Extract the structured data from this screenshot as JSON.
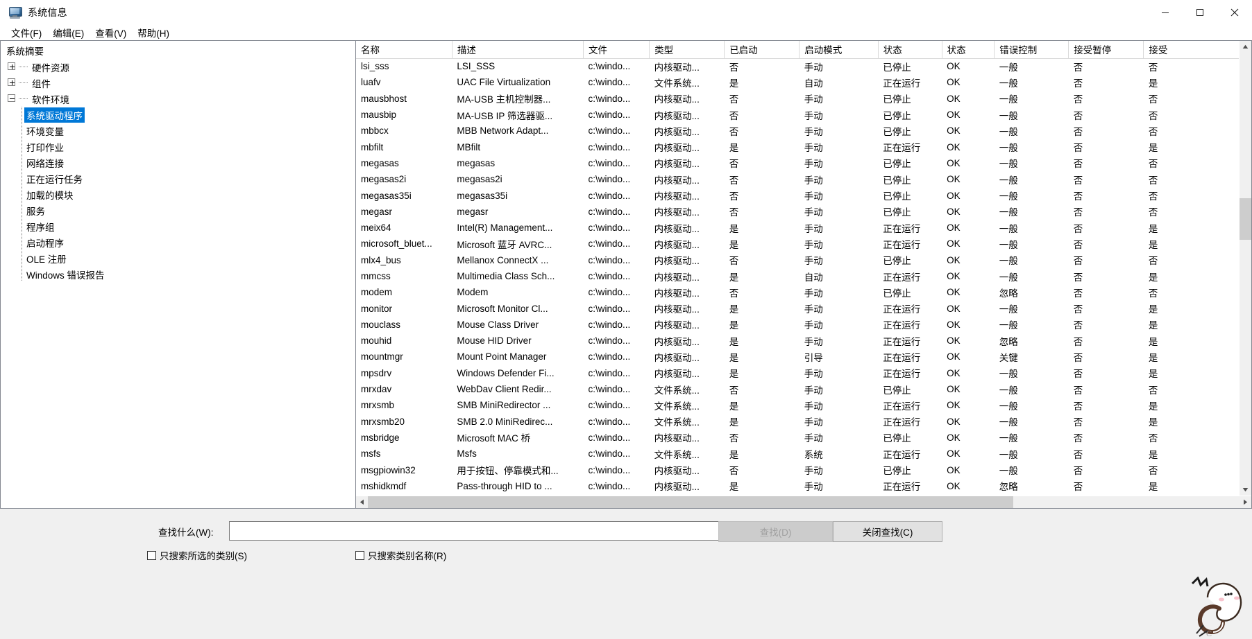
{
  "window": {
    "title": "系统信息",
    "icon": "computer-icon",
    "minimize_label": "最小化",
    "maximize_label": "最大化",
    "close_label": "关闭"
  },
  "menu": {
    "items": [
      {
        "label": "文件(F)"
      },
      {
        "label": "编辑(E)"
      },
      {
        "label": "查看(V)"
      },
      {
        "label": "帮助(H)"
      }
    ]
  },
  "sidebar": {
    "root": "系统摘要",
    "groups": [
      {
        "label": "硬件资源",
        "expanded": false
      },
      {
        "label": "组件",
        "expanded": false
      },
      {
        "label": "软件环境",
        "expanded": true
      }
    ],
    "items": [
      {
        "label": "系统驱动程序",
        "selected": true
      },
      {
        "label": "环境变量",
        "selected": false
      },
      {
        "label": "打印作业",
        "selected": false
      },
      {
        "label": "网络连接",
        "selected": false
      },
      {
        "label": "正在运行任务",
        "selected": false
      },
      {
        "label": "加载的模块",
        "selected": false
      },
      {
        "label": "服务",
        "selected": false
      },
      {
        "label": "程序组",
        "selected": false
      },
      {
        "label": "启动程序",
        "selected": false
      },
      {
        "label": "OLE 注册",
        "selected": false
      },
      {
        "label": "Windows 错误报告",
        "selected": false
      }
    ]
  },
  "table": {
    "columns": [
      "名称",
      "描述",
      "文件",
      "类型",
      "已启动",
      "启动模式",
      "状态",
      "状态",
      "错误控制",
      "接受暂停",
      "接受"
    ],
    "rows": [
      [
        "lsi_sss",
        "LSI_SSS",
        "c:\\windo...",
        "内核驱动...",
        "否",
        "手动",
        "已停止",
        "OK",
        "一般",
        "否",
        "否"
      ],
      [
        "luafv",
        "UAC File Virtualization",
        "c:\\windo...",
        "文件系统...",
        "是",
        "自动",
        "正在运行",
        "OK",
        "一般",
        "否",
        "是"
      ],
      [
        "mausbhost",
        "MA-USB 主机控制器...",
        "c:\\windo...",
        "内核驱动...",
        "否",
        "手动",
        "已停止",
        "OK",
        "一般",
        "否",
        "否"
      ],
      [
        "mausbip",
        "MA-USB IP 筛选器驱...",
        "c:\\windo...",
        "内核驱动...",
        "否",
        "手动",
        "已停止",
        "OK",
        "一般",
        "否",
        "否"
      ],
      [
        "mbbcx",
        "MBB Network Adapt...",
        "c:\\windo...",
        "内核驱动...",
        "否",
        "手动",
        "已停止",
        "OK",
        "一般",
        "否",
        "否"
      ],
      [
        "mbfilt",
        "MBfilt",
        "c:\\windo...",
        "内核驱动...",
        "是",
        "手动",
        "正在运行",
        "OK",
        "一般",
        "否",
        "是"
      ],
      [
        "megasas",
        "megasas",
        "c:\\windo...",
        "内核驱动...",
        "否",
        "手动",
        "已停止",
        "OK",
        "一般",
        "否",
        "否"
      ],
      [
        "megasas2i",
        "megasas2i",
        "c:\\windo...",
        "内核驱动...",
        "否",
        "手动",
        "已停止",
        "OK",
        "一般",
        "否",
        "否"
      ],
      [
        "megasas35i",
        "megasas35i",
        "c:\\windo...",
        "内核驱动...",
        "否",
        "手动",
        "已停止",
        "OK",
        "一般",
        "否",
        "否"
      ],
      [
        "megasr",
        "megasr",
        "c:\\windo...",
        "内核驱动...",
        "否",
        "手动",
        "已停止",
        "OK",
        "一般",
        "否",
        "否"
      ],
      [
        "meix64",
        "Intel(R) Management...",
        "c:\\windo...",
        "内核驱动...",
        "是",
        "手动",
        "正在运行",
        "OK",
        "一般",
        "否",
        "是"
      ],
      [
        "microsoft_bluet...",
        "Microsoft 蓝牙 AVRC...",
        "c:\\windo...",
        "内核驱动...",
        "是",
        "手动",
        "正在运行",
        "OK",
        "一般",
        "否",
        "是"
      ],
      [
        "mlx4_bus",
        "Mellanox ConnectX ...",
        "c:\\windo...",
        "内核驱动...",
        "否",
        "手动",
        "已停止",
        "OK",
        "一般",
        "否",
        "否"
      ],
      [
        "mmcss",
        "Multimedia Class Sch...",
        "c:\\windo...",
        "内核驱动...",
        "是",
        "自动",
        "正在运行",
        "OK",
        "一般",
        "否",
        "是"
      ],
      [
        "modem",
        "Modem",
        "c:\\windo...",
        "内核驱动...",
        "否",
        "手动",
        "已停止",
        "OK",
        "忽略",
        "否",
        "否"
      ],
      [
        "monitor",
        "Microsoft Monitor Cl...",
        "c:\\windo...",
        "内核驱动...",
        "是",
        "手动",
        "正在运行",
        "OK",
        "一般",
        "否",
        "是"
      ],
      [
        "mouclass",
        "Mouse Class Driver",
        "c:\\windo...",
        "内核驱动...",
        "是",
        "手动",
        "正在运行",
        "OK",
        "一般",
        "否",
        "是"
      ],
      [
        "mouhid",
        "Mouse HID Driver",
        "c:\\windo...",
        "内核驱动...",
        "是",
        "手动",
        "正在运行",
        "OK",
        "忽略",
        "否",
        "是"
      ],
      [
        "mountmgr",
        "Mount Point Manager",
        "c:\\windo...",
        "内核驱动...",
        "是",
        "引导",
        "正在运行",
        "OK",
        "关键",
        "否",
        "是"
      ],
      [
        "mpsdrv",
        "Windows Defender Fi...",
        "c:\\windo...",
        "内核驱动...",
        "是",
        "手动",
        "正在运行",
        "OK",
        "一般",
        "否",
        "是"
      ],
      [
        "mrxdav",
        "WebDav Client Redir...",
        "c:\\windo...",
        "文件系统...",
        "否",
        "手动",
        "已停止",
        "OK",
        "一般",
        "否",
        "否"
      ],
      [
        "mrxsmb",
        "SMB MiniRedirector ...",
        "c:\\windo...",
        "文件系统...",
        "是",
        "手动",
        "正在运行",
        "OK",
        "一般",
        "否",
        "是"
      ],
      [
        "mrxsmb20",
        "SMB 2.0 MiniRedirec...",
        "c:\\windo...",
        "文件系统...",
        "是",
        "手动",
        "正在运行",
        "OK",
        "一般",
        "否",
        "是"
      ],
      [
        "msbridge",
        "Microsoft MAC 桥",
        "c:\\windo...",
        "内核驱动...",
        "否",
        "手动",
        "已停止",
        "OK",
        "一般",
        "否",
        "否"
      ],
      [
        "msfs",
        "Msfs",
        "c:\\windo...",
        "文件系统...",
        "是",
        "系统",
        "正在运行",
        "OK",
        "一般",
        "否",
        "是"
      ],
      [
        "msgpiowin32",
        "用于按钮、停靠模式和...",
        "c:\\windo...",
        "内核驱动...",
        "否",
        "手动",
        "已停止",
        "OK",
        "一般",
        "否",
        "否"
      ],
      [
        "mshidkmdf",
        "Pass-through HID to ...",
        "c:\\windo...",
        "内核驱动...",
        "是",
        "手动",
        "正在运行",
        "OK",
        "忽略",
        "否",
        "是"
      ]
    ]
  },
  "find": {
    "label": "查找什么(W):",
    "input_value": "",
    "input_placeholder": "",
    "find_button": "查找(D)",
    "find_button_disabled": true,
    "close_button": "关闭查找(C)",
    "checkbox_selected_category": "只搜索所选的类别(S)",
    "checkbox_selected_category_checked": false,
    "checkbox_category_names": "只搜索类别名称(R)",
    "checkbox_category_names_checked": false
  },
  "colors": {
    "selection": "#0078d7",
    "window_bg": "#f0f0f0",
    "pane_bg": "#ffffff",
    "border": "#828790",
    "scrollbar_thumb": "#cdcdcd"
  }
}
